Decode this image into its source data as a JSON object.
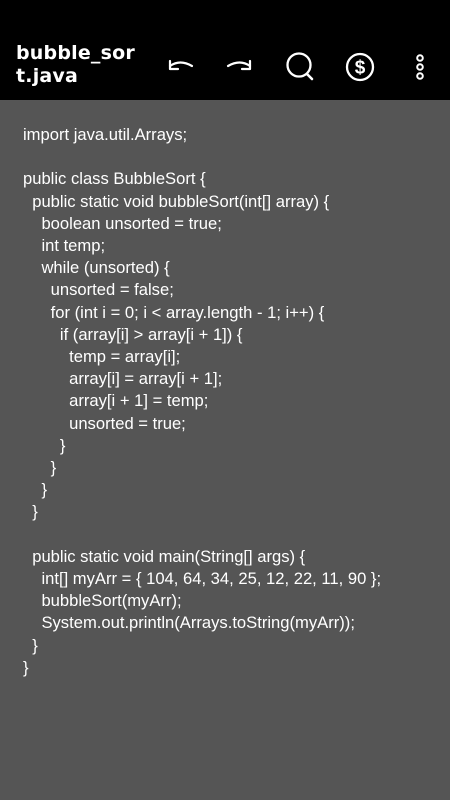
{
  "app_bar": {
    "title": "bubble_sort.java",
    "icons": [
      "undo-icon",
      "redo-icon",
      "search-icon",
      "dollar-icon",
      "more-vert-icon"
    ]
  },
  "editor": {
    "code": "import java.util.Arrays;\n\npublic class BubbleSort {\n  public static void bubbleSort(int[] array) {\n    boolean unsorted = true;\n    int temp;\n    while (unsorted) {\n      unsorted = false;\n      for (int i = 0; i < array.length - 1; i++) {\n        if (array[i] > array[i + 1]) {\n          temp = array[i];\n          array[i] = array[i + 1];\n          array[i + 1] = temp;\n          unsorted = true;\n        }\n      }\n    }\n  }\n\n  public static void main(String[] args) {\n    int[] myArr = { 104, 64, 34, 25, 12, 22, 11, 90 };\n    bubbleSort(myArr);\n    System.out.println(Arrays.toString(myArr));\n  }\n}"
  },
  "colors": {
    "app_bar_bg": "#000000",
    "editor_bg": "#555555",
    "text": "#ffffff"
  }
}
